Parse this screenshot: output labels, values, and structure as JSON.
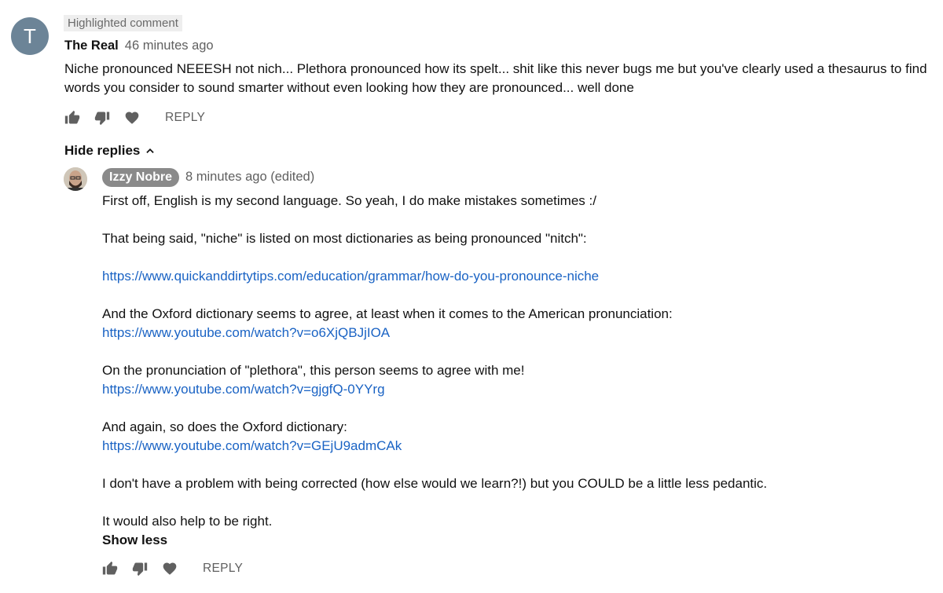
{
  "top_comment": {
    "avatar_letter": "T",
    "badge": "Highlighted comment",
    "author": "The Real",
    "time": "46 minutes ago",
    "text": "Niche pronounced NEEESH not nich... Plethora pronounced how its spelt...  shit like this never bugs me but you've clearly used a thesaurus to find words you consider to sound smarter without even looking how they are pronounced... well done",
    "reply_label": "REPLY"
  },
  "replies_toggle": {
    "label": "Hide replies"
  },
  "reply": {
    "author": "Izzy Nobre",
    "time": "8 minutes ago (edited)",
    "lines": {
      "l1": "First off, English is my second language. So yeah, I do make mistakes sometimes :/",
      "l2": "That being said, \"niche\" is listed on most dictionaries as being pronounced \"nitch\":",
      "link1": "https://www.quickanddirtytips.com/education/grammar/how-do-you-pronounce-niche",
      "l3": "And the Oxford dictionary seems to agree, at least when it comes to the American pronunciation:",
      "link2": "https://www.youtube.com/watch?v=o6XjQBJjIOA",
      "l4": "On the pronunciation of \"plethora\", this person seems to agree with me!",
      "link3": "https://www.youtube.com/watch?v=gjgfQ-0YYrg",
      "l5": "And again, so does the Oxford dictionary:",
      "link4": "https://www.youtube.com/watch?v=GEjU9admCAk",
      "l6": "I don't have a problem with being corrected (how else would we learn?!) but you COULD be a little less pedantic.",
      "l7": "It would also help to be right."
    },
    "show_less": "Show less",
    "reply_label": "REPLY"
  },
  "icons": [
    "thumbs-up-icon",
    "thumbs-down-icon",
    "heart-icon",
    "chevron-up-icon"
  ],
  "colors": {
    "link": "#1a63c4",
    "avatar_bg": "#6c8497",
    "author_pill": "#8a8a8a",
    "icon": "#606060"
  }
}
